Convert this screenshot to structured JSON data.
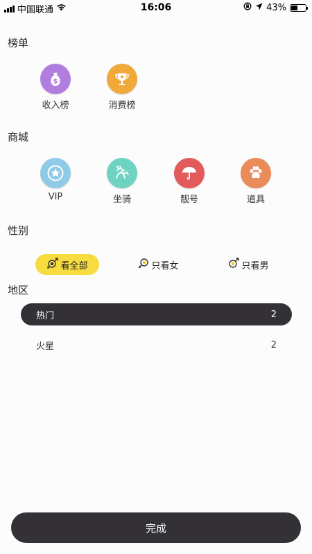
{
  "status_bar": {
    "carrier": "中国联通",
    "time": "16:06",
    "battery": "43%"
  },
  "sections": {
    "ranking": "榜单",
    "mall": "商城",
    "gender": "性别",
    "region": "地区"
  },
  "ranking_items": [
    {
      "label": "收入榜",
      "icon": "money-bag-icon",
      "color": "#b17ddf"
    },
    {
      "label": "消费榜",
      "icon": "trophy-icon",
      "color": "#f0a93a"
    }
  ],
  "mall_items": [
    {
      "label": "VIP",
      "icon": "star-badge-icon",
      "color": "#8fcbe7"
    },
    {
      "label": "坐骑",
      "icon": "deer-icon",
      "color": "#6fd3c1"
    },
    {
      "label": "靓号",
      "icon": "umbrella-icon",
      "color": "#e35a5c"
    },
    {
      "label": "道具",
      "icon": "paw-icon",
      "color": "#ea8b5a"
    }
  ],
  "gender_options": [
    {
      "label": "看全部",
      "icon": "gender-all-icon",
      "active": true
    },
    {
      "label": "只看女",
      "icon": "female-icon",
      "active": false
    },
    {
      "label": "只看男",
      "icon": "male-icon",
      "active": false
    }
  ],
  "region_rows": [
    {
      "name": "热门",
      "count": "2",
      "active": true
    },
    {
      "name": "火星",
      "count": "2",
      "active": false
    }
  ],
  "done_label": "完成",
  "colors": {
    "accent_yellow": "#f6dc3f",
    "dark": "#333135"
  }
}
